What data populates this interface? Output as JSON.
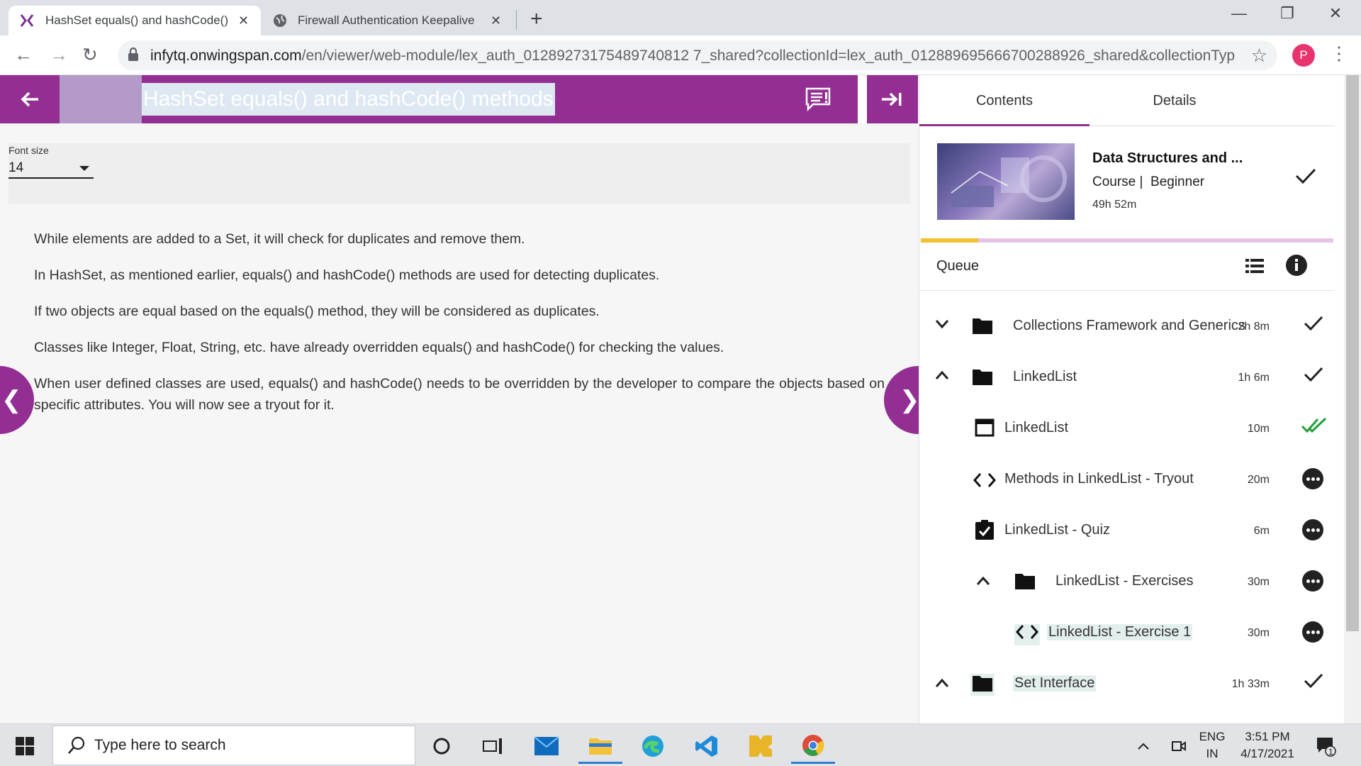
{
  "browser": {
    "tabs": [
      {
        "title": "HashSet equals() and hashCode()",
        "active": true
      },
      {
        "title": "Firewall Authentication Keepalive",
        "active": false
      }
    ],
    "url_host": "infytq.onwingspan.com",
    "url_path": "/en/viewer/web-module/lex_auth_01289273175489740812 7_shared?collectionId=lex_auth_012889695666700288926_shared&collectionType...",
    "profile_initial": "P"
  },
  "header": {
    "title": "HashSet equals() and hashCode() methods"
  },
  "font_size": {
    "label": "Font size",
    "value": "14"
  },
  "article": {
    "paragraphs": [
      "While elements are added to a Set, it will check for duplicates and remove them.",
      "In HashSet, as mentioned earlier, equals() and hashCode() methods are used for detecting duplicates.",
      "If two objects are equal based on the equals() method, they will be considered as duplicates.",
      "Classes like Integer, Float, String, etc. have already overridden equals() and hashCode() for checking the values.",
      "When user defined classes are used, equals() and hashCode() needs to be overridden by the developer to compare the objects based on specific attributes. You will now see a tryout for it."
    ]
  },
  "side_panel": {
    "tabs": [
      "Contents",
      "Details"
    ],
    "course": {
      "title": "Data Structures and ...",
      "type": "Course",
      "level": "Beginner",
      "duration": "49h 52m",
      "progress": 0.14
    },
    "queue_label": "Queue",
    "items": [
      {
        "label": "Collections Framework and Generics",
        "time": "2h 8m",
        "icon": "folder-icon",
        "status": "done"
      },
      {
        "label": "LinkedList",
        "time": "1h 6m",
        "icon": "folder-icon",
        "status": "done"
      },
      {
        "label": "LinkedList",
        "time": "10m",
        "icon": "window-icon",
        "status": "completed-double"
      },
      {
        "label": "Methods in LinkedList - Tryout",
        "time": "20m",
        "icon": "code-icon",
        "status": "pending"
      },
      {
        "label": "LinkedList - Quiz",
        "time": "6m",
        "icon": "quiz-icon",
        "status": "pending"
      },
      {
        "label": "LinkedList - Exercises",
        "time": "30m",
        "icon": "folder-icon",
        "status": "pending"
      },
      {
        "label": "LinkedList - Exercise 1",
        "time": "30m",
        "icon": "code-icon",
        "status": "pending"
      },
      {
        "label": "Set Interface",
        "time": "1h 33m",
        "icon": "folder-icon",
        "status": "done"
      }
    ]
  },
  "taskbar": {
    "search_placeholder": "Type here to search",
    "lang_line1": "ENG",
    "lang_line2": "IN",
    "time": "3:51 PM",
    "date": "4/17/2021",
    "notification_count": "1"
  },
  "colors": {
    "brand_purple": "#932f92",
    "progress_yellow": "#f2c230",
    "done_green": "#21a038"
  }
}
